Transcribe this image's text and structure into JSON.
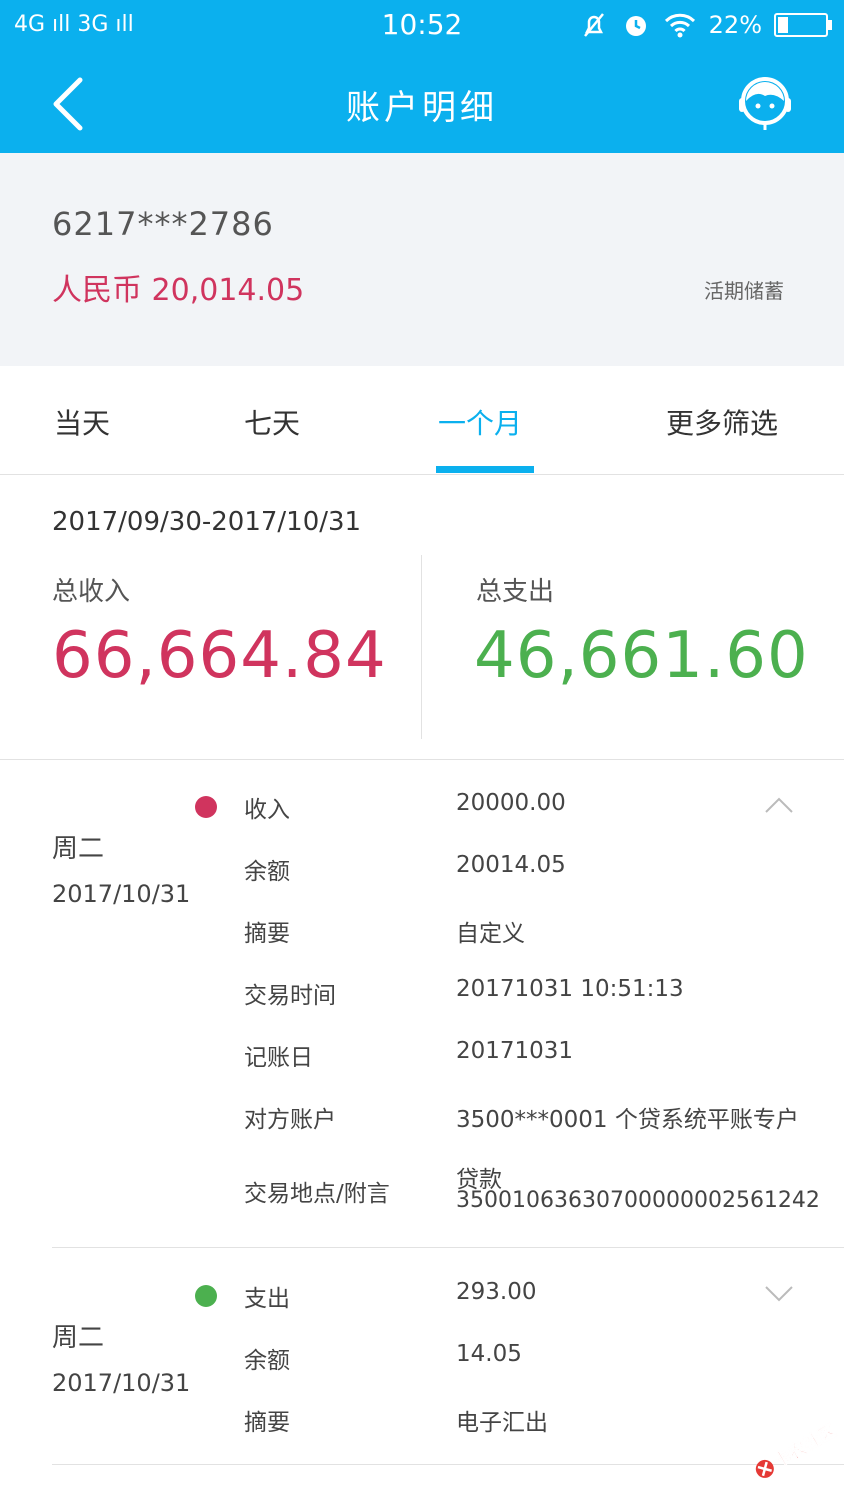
{
  "status_bar": {
    "signal": "4G ıll 3G ıll",
    "time": "10:52",
    "battery": "22%",
    "battery_level_percent": 22
  },
  "nav": {
    "title": "账户明细"
  },
  "account": {
    "number": "6217***2786",
    "balance": "人民币 20,014.05",
    "type": "活期储蓄"
  },
  "tabs": [
    {
      "label": "当天",
      "active": false
    },
    {
      "label": "七天",
      "active": false
    },
    {
      "label": "一个月",
      "active": true
    },
    {
      "label": "更多筛选",
      "active": false
    }
  ],
  "summary": {
    "range": "2017/09/30-2017/10/31",
    "income_label": "总收入",
    "income_value": "66,664.84",
    "expense_label": "总支出",
    "expense_value": "46,661.60"
  },
  "transactions": [
    {
      "weekday": "周二",
      "date": "2017/10/31",
      "type_label": "收入",
      "amount": "20000.00",
      "expanded": true,
      "details": [
        {
          "label": "余额",
          "value": "20014.05"
        },
        {
          "label": "摘要",
          "value": "自定义"
        },
        {
          "label": "交易时间",
          "value": "20171031 10:51:13"
        },
        {
          "label": "记账日",
          "value": "20171031"
        },
        {
          "label": "对方账户",
          "value": "3500***0001 个贷系统平账专户"
        },
        {
          "label": "交易地点/附言",
          "value": "贷款",
          "value2": "35001063630700000002561242"
        }
      ]
    },
    {
      "weekday": "周二",
      "date": "2017/10/31",
      "type_label": "支出",
      "amount": "293.00",
      "expanded": false,
      "details": [
        {
          "label": "余额",
          "value": "14.05"
        },
        {
          "label": "摘要",
          "value": "电子汇出"
        }
      ]
    }
  ],
  "watermark": "卡农社区",
  "colors": {
    "primary": "#0bb0ee",
    "income": "#d0345e",
    "expense": "#4cb04f"
  }
}
